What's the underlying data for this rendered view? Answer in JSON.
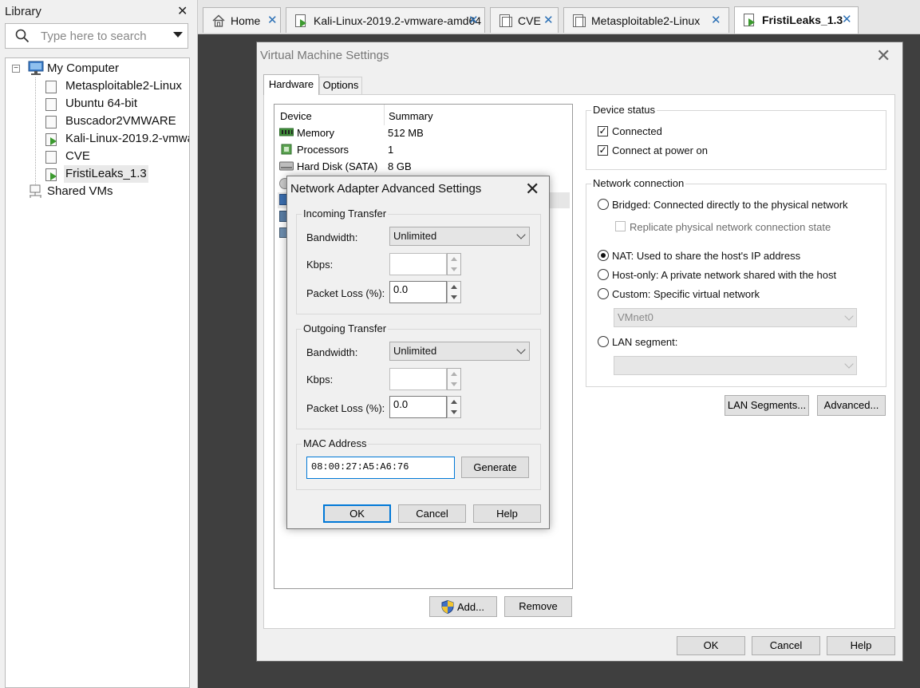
{
  "library": {
    "title": "Library",
    "search_placeholder": "Type here to search",
    "tree": {
      "root": "My Computer",
      "items": [
        {
          "label": "Metasploitable2-Linux",
          "running": false
        },
        {
          "label": "Ubuntu 64-bit",
          "running": false
        },
        {
          "label": "Buscador2VMWARE",
          "running": false
        },
        {
          "label": "Kali-Linux-2019.2-vmwa",
          "running": true
        },
        {
          "label": "CVE",
          "running": false
        },
        {
          "label": "FristiLeaks_1.3",
          "running": true,
          "selected": true
        }
      ],
      "shared": "Shared VMs"
    }
  },
  "tabs": [
    {
      "label": "Home"
    },
    {
      "label": "Kali-Linux-2019.2-vmware-amd64"
    },
    {
      "label": "CVE"
    },
    {
      "label": "Metasploitable2-Linux"
    },
    {
      "label": "FristiLeaks_1.3",
      "active": true
    }
  ],
  "vm_settings": {
    "title": "Virtual Machine Settings",
    "tabs": {
      "hardware": "Hardware",
      "options": "Options"
    },
    "device_list": {
      "headers": {
        "device": "Device",
        "summary": "Summary"
      },
      "rows": [
        {
          "device": "Memory",
          "summary": "512 MB"
        },
        {
          "device": "Processors",
          "summary": "1"
        },
        {
          "device": "Hard Disk (SATA)",
          "summary": "8 GB"
        }
      ]
    },
    "add_button": "Add...",
    "remove_button": "Remove",
    "device_status": {
      "title": "Device status",
      "connected": "Connected",
      "connect_at_power_on": "Connect at power on"
    },
    "network_connection": {
      "title": "Network connection",
      "bridged": "Bridged: Connected directly to the physical network",
      "replicate": "Replicate physical network connection state",
      "nat": "NAT: Used to share the host's IP address",
      "host_only": "Host-only: A private network shared with the host",
      "custom": "Custom: Specific virtual network",
      "vmnet": "VMnet0",
      "lan_segment": "LAN segment:"
    },
    "lan_segments_button": "LAN Segments...",
    "advanced_button": "Advanced...",
    "ok": "OK",
    "cancel": "Cancel",
    "help": "Help"
  },
  "network_adapter_dialog": {
    "title": "Network Adapter Advanced Settings",
    "incoming": {
      "title": "Incoming Transfer",
      "bandwidth_label": "Bandwidth:",
      "bandwidth_value": "Unlimited",
      "kbps_label": "Kbps:",
      "kbps_value": "",
      "packet_loss_label": "Packet Loss (%):",
      "packet_loss_value": "0.0"
    },
    "outgoing": {
      "title": "Outgoing Transfer",
      "bandwidth_label": "Bandwidth:",
      "bandwidth_value": "Unlimited",
      "kbps_label": "Kbps:",
      "kbps_value": "",
      "packet_loss_label": "Packet Loss (%):",
      "packet_loss_value": "0.0"
    },
    "mac": {
      "title": "MAC Address",
      "value": "08:00:27:A5:A6:76",
      "generate": "Generate"
    },
    "ok": "OK",
    "cancel": "Cancel",
    "help": "Help"
  },
  "colors": {
    "accent": "#0078d7",
    "tab_close": "#2a6fb5",
    "vm_running": "#3c9a2f",
    "dark_background": "#3f3f3f"
  }
}
